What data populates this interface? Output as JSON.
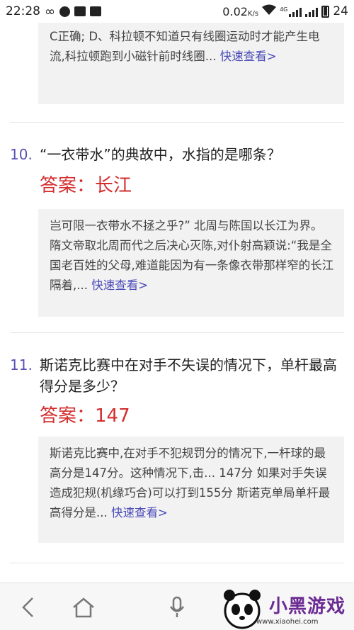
{
  "statusbar": {
    "time": "22:28",
    "speed": "0.02",
    "speed_unit": "K/s",
    "battery": "24",
    "net_label": "4G"
  },
  "items": [
    {
      "snippet": "C正确; D、科拉顿不知道只有线圈运动时才能产生电流,科拉顿跑到小磁针前时线圈...",
      "more": "快速查看>"
    },
    {
      "number": "10.",
      "question": "“一衣带水”的典故中，水指的是哪条？",
      "answer": "答案：长江",
      "snippet": "岂可限一衣带水不拯之乎?” 北周与陈国以长江为界。隋文帝取北周而代之后决心灭陈,对仆射高颖说:“我是全国老百姓的父母,难道能因为有一条像衣带那样窄的长江隔着,...",
      "more": "快速查看>"
    },
    {
      "number": "11.",
      "question": "斯诺克比赛中在对手不失误的情况下，单杆最高得分是多少？",
      "answer": "答案：147",
      "snippet": "斯诺克比赛中,在对手不犯规罚分的情况下,一杆球的最高分是147分。这种情况下,击... 147分 如果对手失误造成犯规(机缘巧合)可以打到155分 斯诺克单局单杆最高得分是...",
      "more": "快速查看>"
    }
  ],
  "logo": {
    "text": "小黑游戏",
    "url": "www.xiaohei.com"
  }
}
